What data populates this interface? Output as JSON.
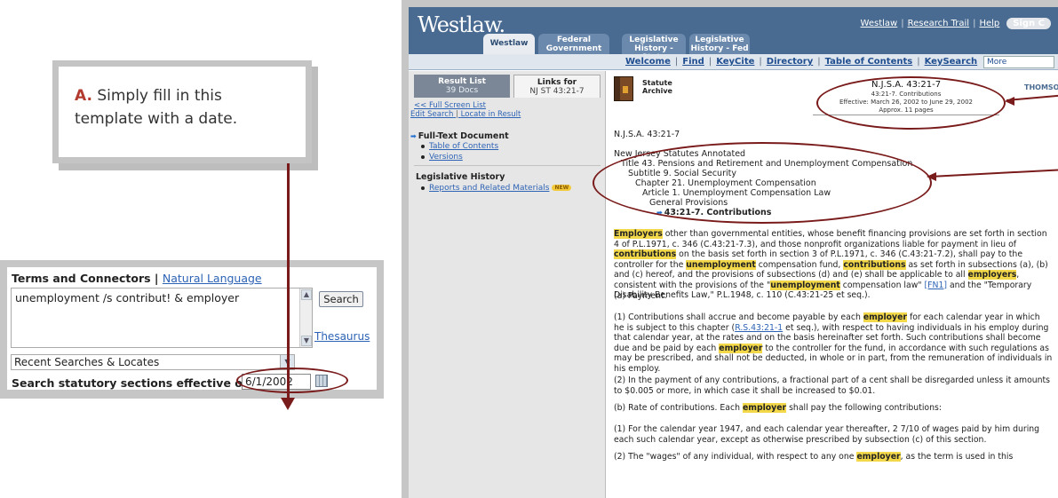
{
  "callout": {
    "letter": "A.",
    "text": "Simply fill in this template with a date."
  },
  "search": {
    "mode_active": "Terms and Connectors",
    "mode_sep": " | ",
    "mode_other": "Natural Language",
    "query": "unemployment /s contribut! & employer",
    "search_button": "Search",
    "thesaurus_link": "Thesaurus",
    "recent_select": "Recent Searches & Locates",
    "date_label": "Search statutory sections effective on:",
    "date_value": "6/1/2002"
  },
  "westlaw": {
    "logo": "Westlaw.",
    "top_links": [
      "Westlaw",
      "Research Trail",
      "Help"
    ],
    "sign_off": "Sign C",
    "tabs": [
      {
        "label": "Westlaw",
        "active": true
      },
      {
        "label": "Federal Government",
        "active": false
      },
      {
        "label": "Legislative History - State",
        "active": false
      },
      {
        "label": "Legislative History - Fed",
        "active": false
      }
    ],
    "subnav": [
      "Welcome",
      "Find",
      "KeyCite",
      "Directory",
      "Table of Contents",
      "KeySearch"
    ],
    "more_placeholder": "More",
    "left": {
      "tab_result": "Result List",
      "tab_result_sub": "39 Docs",
      "tab_links": "Links for",
      "tab_links_sub": "NJ ST 43:21-7",
      "full_screen": "<< Full Screen List",
      "edit_search": "Edit Search",
      "locate": "Locate in Result",
      "fulltext_heading": "Full-Text Document",
      "toc": "Table of Contents",
      "versions": "Versions",
      "leg_heading": "Legislative History",
      "reports": "Reports and Related Materials",
      "new_badge": "NEW"
    },
    "doc": {
      "archive_label_1": "Statute",
      "archive_label_2": "Archive",
      "cite": "N.J.S.A. 43:21-7",
      "cite_sub1": "43:21-7. Contributions",
      "cite_sub2": "Effective: March 26, 2002 to June 29, 2002",
      "cite_sub3": "Approx. 11 pages",
      "thomson": "THOMSON",
      "cite_line": "N.J.S.A. 43:21-7",
      "h1": "New Jersey Statutes Annotated",
      "h2": "Title 43. Pensions and Retirement and Unemployment Compensation",
      "h3": "Subtitle 9. Social Security",
      "h4": "Chapter 21. Unemployment Compensation",
      "h5": "Article 1. Unemployment Compensation Law",
      "h6": "General Provisions",
      "h7": "43:21-7. Contributions",
      "payment_heading": "(a) Payment.",
      "p_b": "(b) Rate of contributions. Each",
      "p_b_hl": "employer",
      "p_b_end": "shall pay the following contributions:",
      "p_2": "(2) In the payment of any contributions, a fractional part of a cent shall be disregarded unless it amounts to $0.005 or more, in which case it shall be increased to $0.01.",
      "p_1947": "(1) For the calendar year 1947, and each calendar year thereafter, 2 7/10 of wages paid by him during each such calendar year, except as otherwise prescribed by subsection (c) of this section.",
      "p_wages_a": "(2) The \"wages\" of any individual, with respect to any one",
      "p_wages_hl": "employer",
      "p_wages_b": ", as the term is used in this"
    }
  }
}
